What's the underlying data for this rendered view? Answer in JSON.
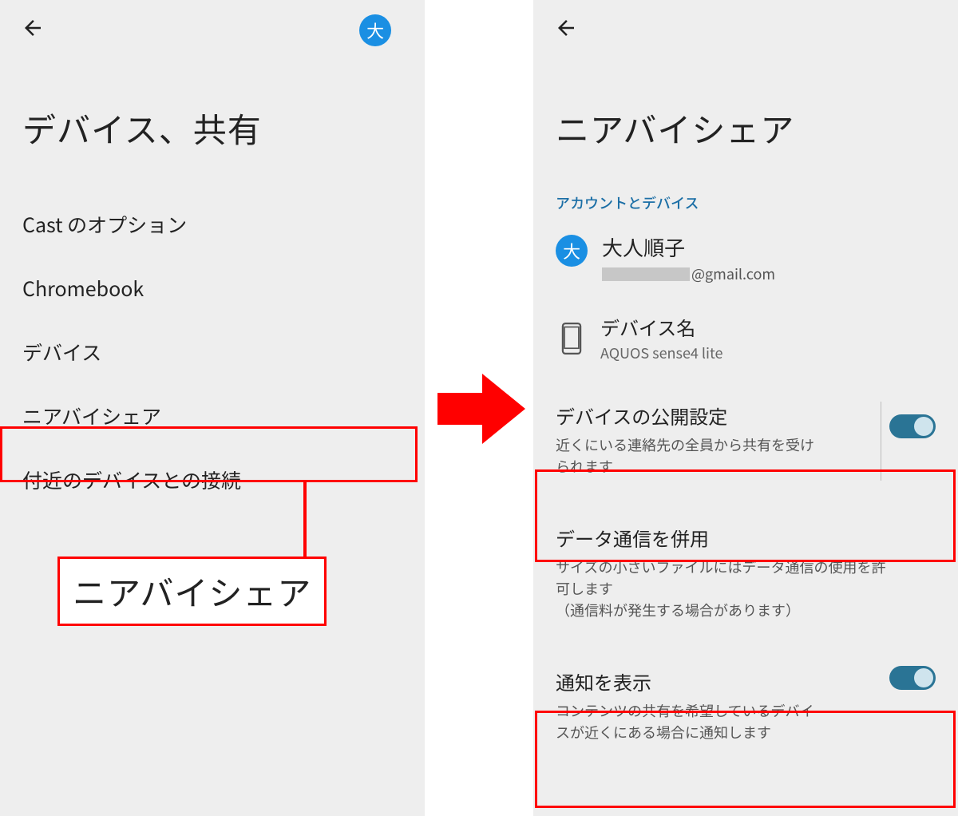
{
  "left": {
    "avatar_char": "大",
    "title": "デバイス、共有",
    "menu": [
      "Cast のオプション",
      "Chromebook",
      "デバイス",
      "ニアバイシェア",
      "付近のデバイスとの接続"
    ],
    "callout": "ニアバイシェア"
  },
  "right": {
    "title": "ニアバイシェア",
    "section_header": "アカウントとデバイス",
    "account": {
      "avatar_char": "大",
      "name": "大人順子",
      "email_suffix": "@gmail.com"
    },
    "device": {
      "label": "デバイス名",
      "value": "AQUOS sense4 lite"
    },
    "settings": [
      {
        "title": "デバイスの公開設定",
        "desc": "近くにいる連絡先の全員から共有を受けられます",
        "toggle": true,
        "has_divider": true,
        "highlight": true
      },
      {
        "title": "データ通信を併用",
        "desc": "サイズの小さいファイルにはデータ通信の使用を許可します\n（通信料が発生する場合があります）",
        "toggle": false,
        "has_divider": false,
        "highlight": false
      },
      {
        "title": "通知を表示",
        "desc": "コンテンツの共有を希望しているデバイスが近くにある場合に通知します",
        "toggle": true,
        "has_divider": false,
        "highlight": true
      }
    ]
  }
}
